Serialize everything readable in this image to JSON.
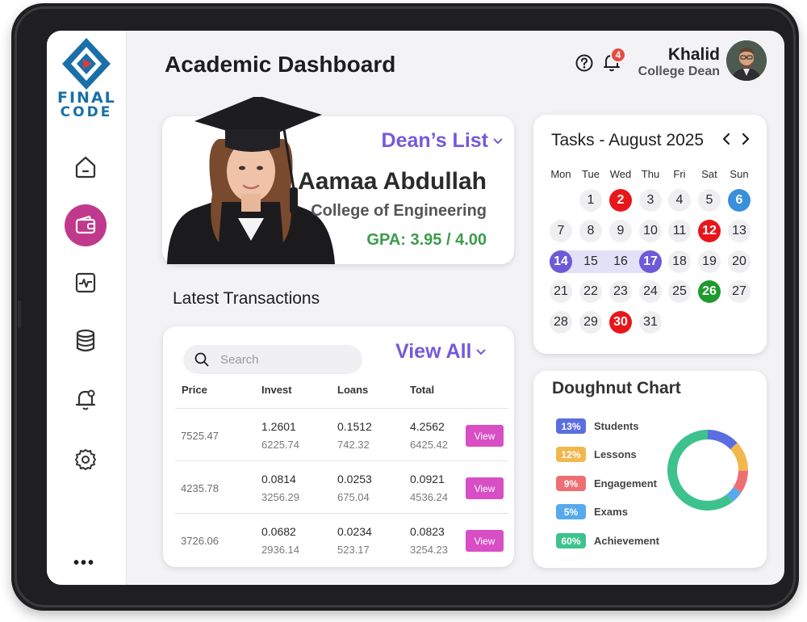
{
  "brand": {
    "logo_line1": "FINAL",
    "logo_line2": "CODE"
  },
  "header": {
    "title": "Academic Dashboard",
    "notification_count": "4",
    "user_name": "Khalid",
    "user_role": "College Dean"
  },
  "sidebar": {
    "items": [
      {
        "icon": "home-icon",
        "active": false
      },
      {
        "icon": "wallet-icon",
        "active": true
      },
      {
        "icon": "activity-icon",
        "active": false
      },
      {
        "icon": "database-icon",
        "active": false
      },
      {
        "icon": "bell-icon",
        "active": false
      },
      {
        "icon": "gear-icon",
        "active": false
      }
    ],
    "more": "•••"
  },
  "student": {
    "badge": "Dean’s List",
    "name": "Aamaa Abdullah",
    "college": "College of Engineering",
    "gpa": "GPA: 3.95 / 4.00"
  },
  "transactions": {
    "section_title": "Latest Transactions",
    "search_placeholder": "Search",
    "view_all": "View All",
    "columns": [
      "Price",
      "Invest",
      "Loans",
      "Total"
    ],
    "rows": [
      {
        "price": "7525.47",
        "invest": "1.2601",
        "invest_sub": "6225.74",
        "loans": "0.1512",
        "loans_sub": "742.32",
        "total": "4.2562",
        "total_sub": "6425.42",
        "action": "View"
      },
      {
        "price": "4235.78",
        "invest": "0.0814",
        "invest_sub": "3256.29",
        "loans": "0.0253",
        "loans_sub": "675.04",
        "total": "0.0921",
        "total_sub": "4536.24",
        "action": "View"
      },
      {
        "price": "3726.06",
        "invest": "0.0682",
        "invest_sub": "2936.14",
        "loans": "0.0234",
        "loans_sub": "523.17",
        "total": "0.0823",
        "total_sub": "3254.23",
        "action": "View"
      }
    ]
  },
  "calendar": {
    "title": "Tasks - August 2025",
    "weekdays": [
      "Mon",
      "Tue",
      "Wed",
      "Thu",
      "Fri",
      "Sat",
      "Sun"
    ],
    "first_weekday_index": 1,
    "days_in_month": 31,
    "highlights": {
      "2": "red",
      "6": "blue",
      "12": "red",
      "14": "purple",
      "17": "purple",
      "26": "green",
      "30": "red"
    },
    "range": [
      14,
      17
    ],
    "colors": {
      "red": "#e8161b",
      "blue": "#3a8fdc",
      "purple": "#6e59d9",
      "green": "#1e9a2e",
      "range": "#e3e1f7"
    }
  },
  "doughnut": {
    "title": "Doughnut Chart",
    "items": [
      {
        "percent": "13%",
        "label": "Students",
        "value": 13,
        "color": "#5b6ee1"
      },
      {
        "percent": "12%",
        "label": "Lessons",
        "value": 12,
        "color": "#f0b84d"
      },
      {
        "percent": "9%",
        "label": "Engagement",
        "value": 9,
        "color": "#ee6f72"
      },
      {
        "percent": "5%",
        "label": "Exams",
        "value": 5,
        "color": "#56a9ec"
      },
      {
        "percent": "60%",
        "label": "Achievement",
        "value": 60,
        "color": "#3ec28d"
      }
    ]
  }
}
